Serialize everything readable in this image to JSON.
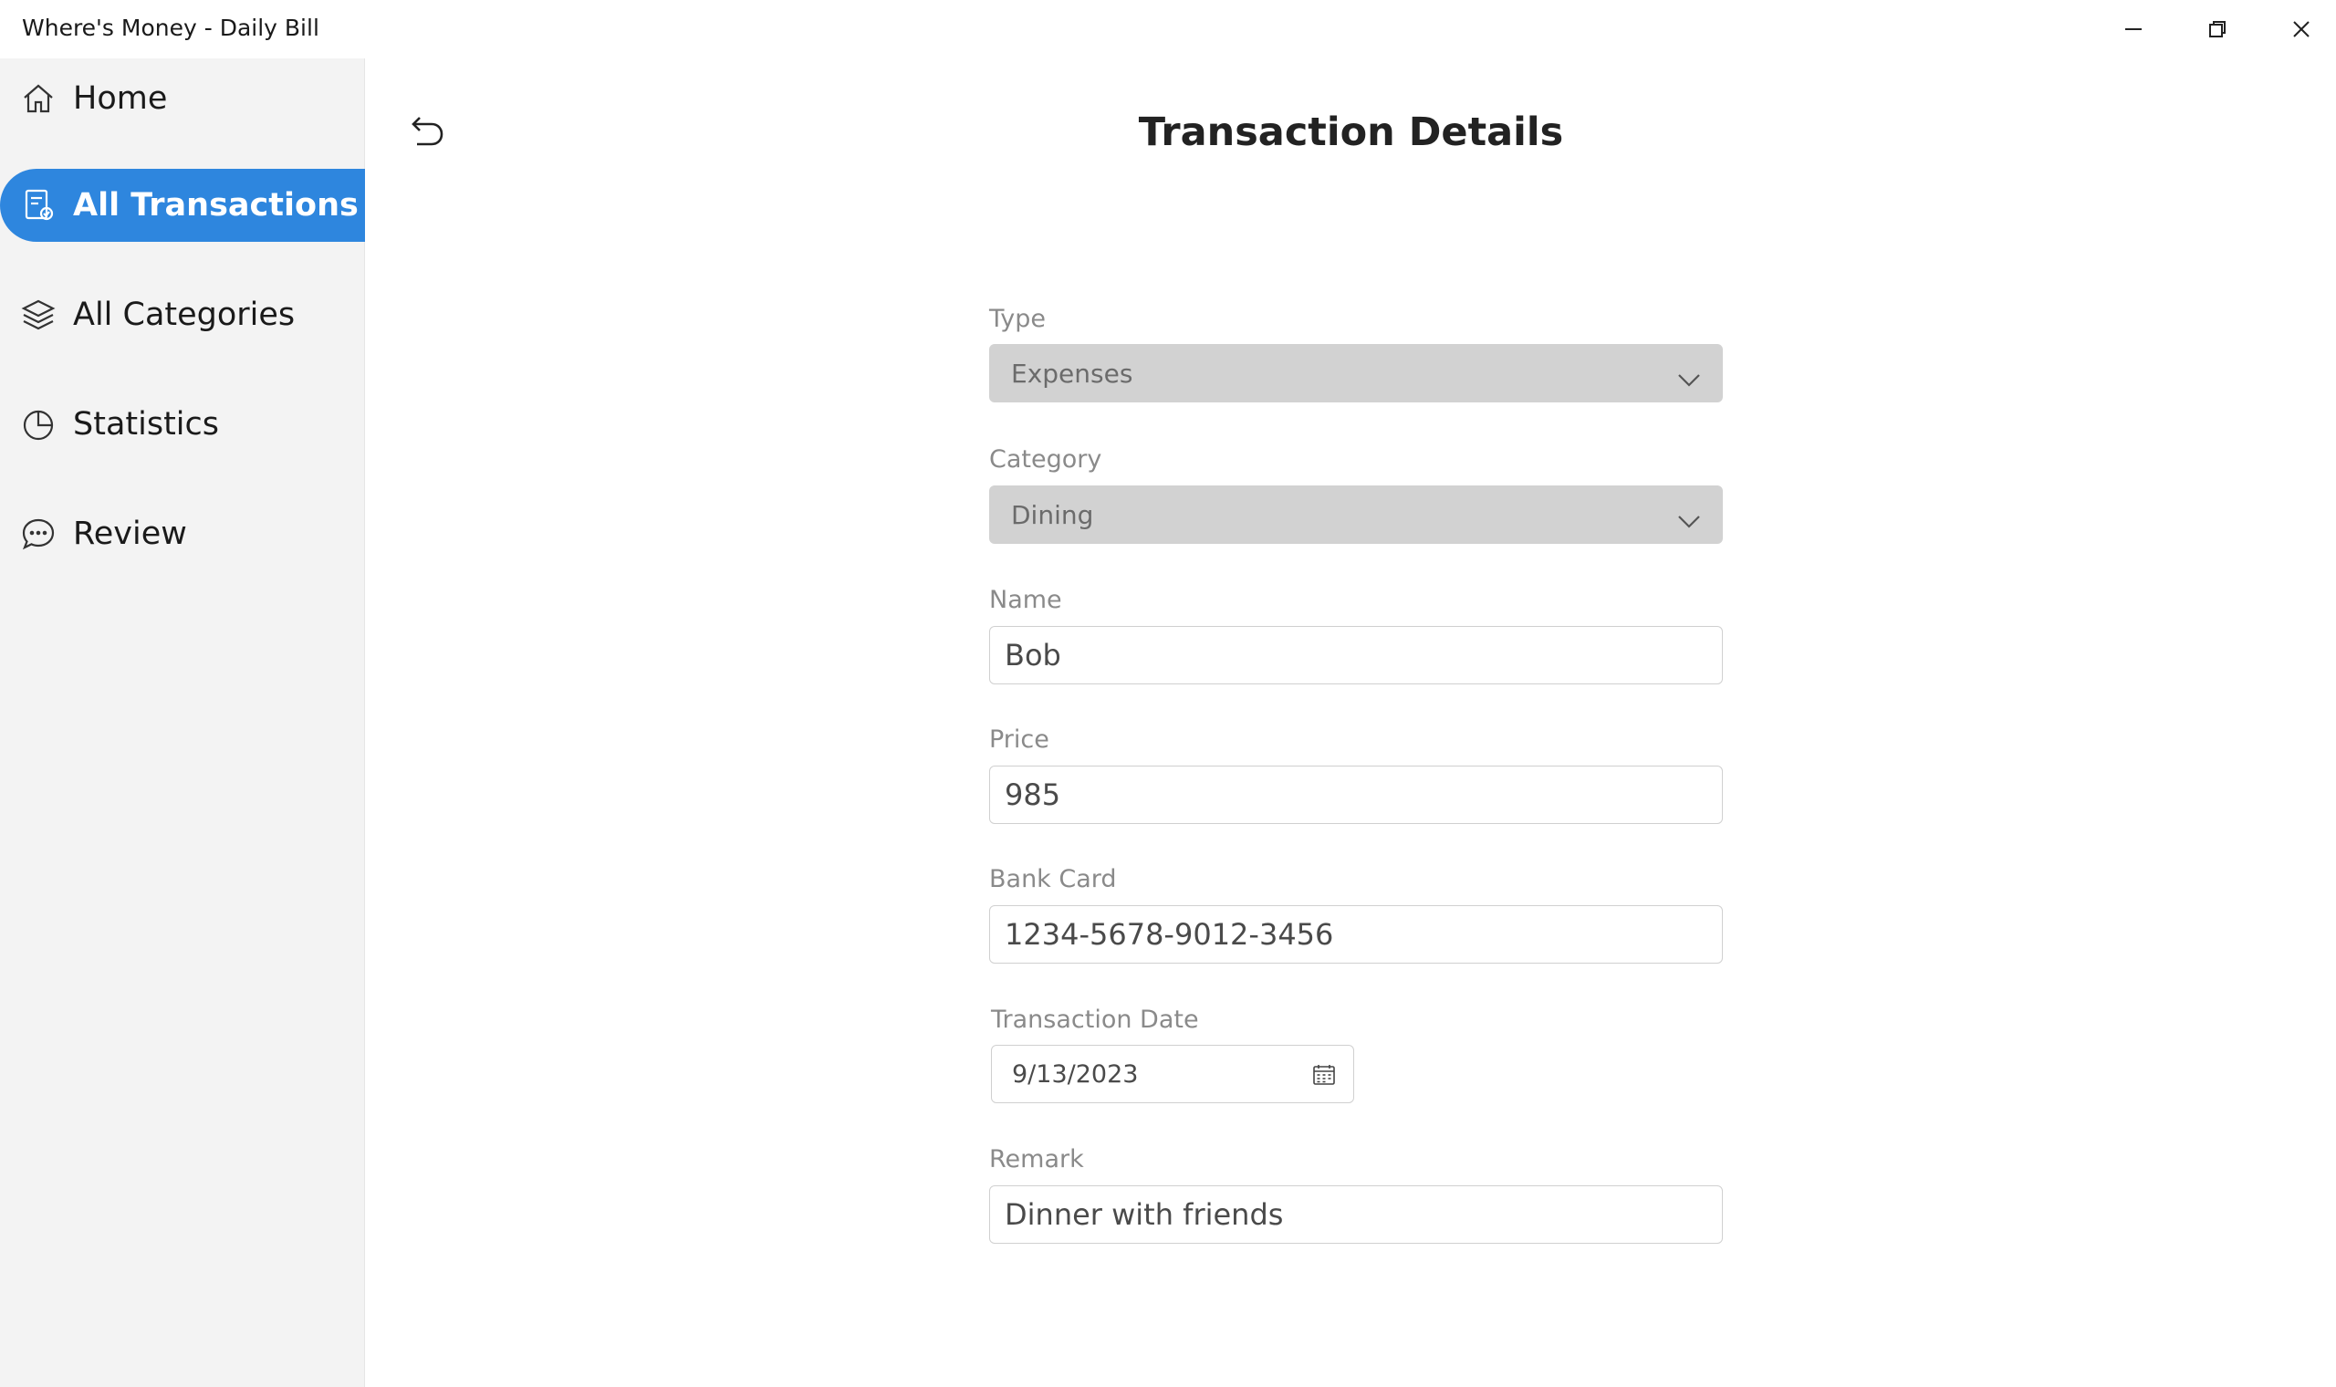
{
  "window": {
    "title": "Where's Money - Daily Bill",
    "controls": [
      "minimize-icon",
      "restore-icon",
      "close-icon"
    ]
  },
  "sidebar": {
    "items": [
      {
        "label": "Home",
        "icon": "home-icon",
        "active": false
      },
      {
        "label": "All Transactions",
        "icon": "transactions-icon",
        "active": true
      },
      {
        "label": "All Categories",
        "icon": "layers-icon",
        "active": false
      },
      {
        "label": "Statistics",
        "icon": "pie-chart-icon",
        "active": false
      },
      {
        "label": "Review",
        "icon": "chat-bubble-icon",
        "active": false
      }
    ],
    "accent_color": "#2e86de"
  },
  "main": {
    "back_icon": "undo-arrow-icon",
    "title": "Transaction Details",
    "form": {
      "type": {
        "label": "Type",
        "value": "Expenses"
      },
      "category": {
        "label": "Category",
        "value": "Dining"
      },
      "name": {
        "label": "Name",
        "value": "Bob"
      },
      "price": {
        "label": "Price",
        "value": "985"
      },
      "bank_card": {
        "label": "Bank Card",
        "value": "1234-5678-9012-3456"
      },
      "transaction_date": {
        "label": "Transaction Date",
        "value": "9/13/2023"
      },
      "remark": {
        "label": "Remark",
        "value": "Dinner with friends"
      }
    }
  }
}
